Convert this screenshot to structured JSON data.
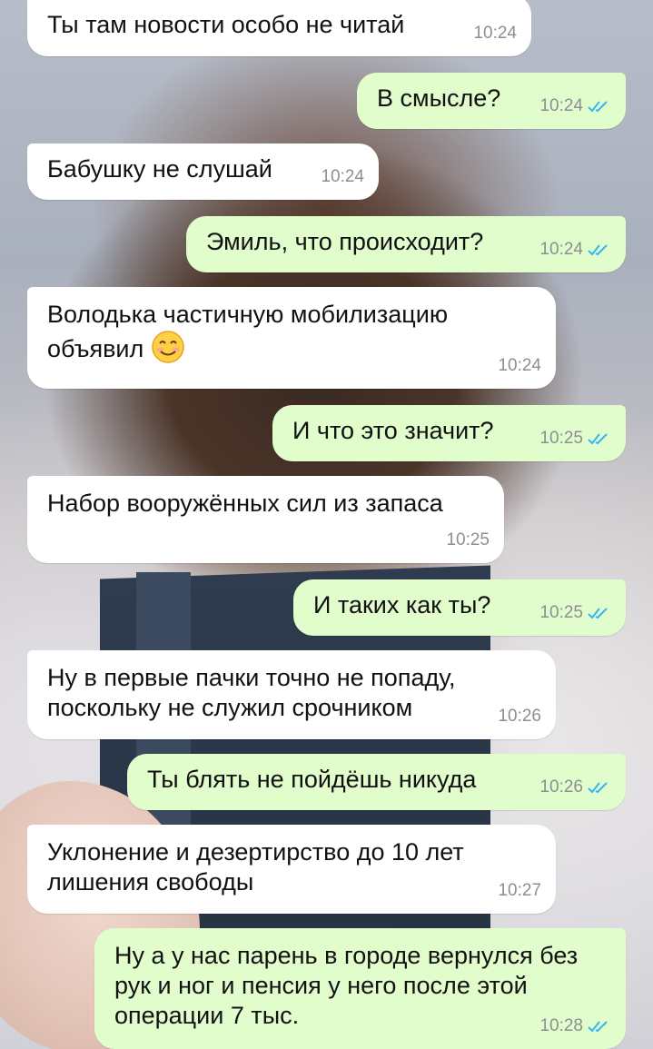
{
  "colors": {
    "incoming_bubble": "#ffffff",
    "outgoing_bubble": "#e2fdcc",
    "time_text": "#8a8f94",
    "read_ticks": "#34b7f1"
  },
  "messages": [
    {
      "dir": "in",
      "text": "Ты там новости особо не читай",
      "time": "10:24"
    },
    {
      "dir": "out",
      "text": "В смысле?",
      "time": "10:24",
      "status": "read"
    },
    {
      "dir": "in",
      "text": "Бабушку не слушай",
      "time": "10:24"
    },
    {
      "dir": "out",
      "text": "Эмиль, что происходит?",
      "time": "10:24",
      "status": "read"
    },
    {
      "dir": "in",
      "text": "Володька частичную мобилизацию объявил",
      "emoji": "smiling-face",
      "time": "10:24"
    },
    {
      "dir": "out",
      "text": "И что это значит?",
      "time": "10:25",
      "status": "read"
    },
    {
      "dir": "in",
      "text": "Набор вооружённых сил из запаса",
      "time": "10:25"
    },
    {
      "dir": "out",
      "text": "И таких как ты?",
      "time": "10:25",
      "status": "read"
    },
    {
      "dir": "in",
      "text": "Ну в первые пачки точно не попаду, поскольку не служил срочником",
      "time": "10:26"
    },
    {
      "dir": "out",
      "text": "Ты блять не пойдёшь никуда",
      "time": "10:26",
      "status": "read"
    },
    {
      "dir": "in",
      "text": "Уклонение и дезертирство до 10 лет лишения свободы",
      "time": "10:27"
    },
    {
      "dir": "out",
      "text": "Ну а у нас парень в городе вернулся без рук и ног и пенсия у него после этой операции 7 тыс.",
      "time": "10:28",
      "status": "read"
    }
  ]
}
